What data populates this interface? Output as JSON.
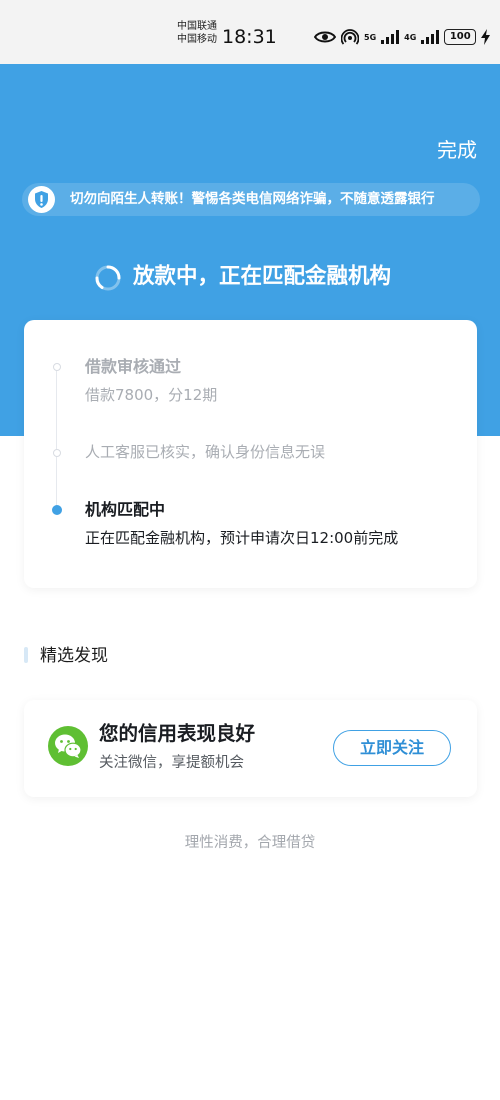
{
  "status_bar": {
    "carrier_primary": "中国联通",
    "carrier_secondary": "中国移动",
    "time": "18:31",
    "sim1_network": "5G",
    "sim2_network": "4G",
    "battery_level": "100"
  },
  "header": {
    "done_label": "完成",
    "warning_text": "切勿向陌生人转账！警惕各类电信网络诈骗，不随意透露银行",
    "loading_title": "放款中，正在匹配金融机构",
    "background_color": "#40a1e4"
  },
  "progress": {
    "steps": [
      {
        "title": "借款审核通过",
        "description": "借款7800，分12期",
        "state": "done"
      },
      {
        "title": "",
        "description": "人工客服已核实，确认身份信息无误",
        "state": "done"
      },
      {
        "title": "机构匹配中",
        "description": "正在匹配金融机构，预计申请次日12:00前完成",
        "state": "active"
      }
    ],
    "active_color": "#40a1e4"
  },
  "discover": {
    "section_title": "精选发现",
    "promo": {
      "icon": "wechat-icon",
      "title": "您的信用表现良好",
      "subtitle": "关注微信，享提额机会",
      "button_label": "立即关注"
    }
  },
  "footer": {
    "note": "理性消费，合理借贷"
  }
}
